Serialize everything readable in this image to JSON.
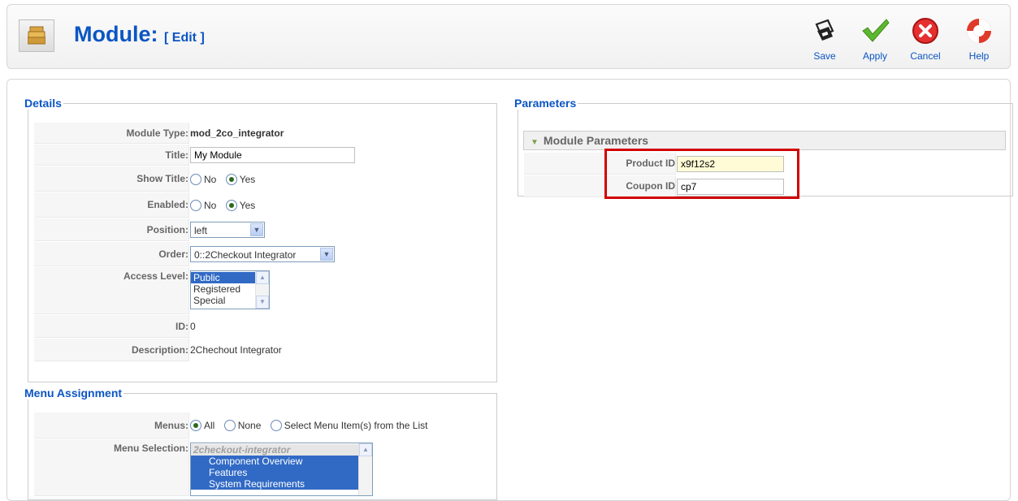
{
  "header": {
    "title": "Module:",
    "subtitle": "[ Edit ]",
    "toolbar": [
      {
        "id": "save",
        "label": "Save",
        "icon": "save-icon"
      },
      {
        "id": "apply",
        "label": "Apply",
        "icon": "checkmark-icon"
      },
      {
        "id": "cancel",
        "label": "Cancel",
        "icon": "cancel-icon"
      },
      {
        "id": "help",
        "label": "Help",
        "icon": "lifebuoy-icon"
      }
    ]
  },
  "details": {
    "legend": "Details",
    "module_type": {
      "label": "Module Type:",
      "value": "mod_2co_integrator"
    },
    "title": {
      "label": "Title:",
      "value": "My Module"
    },
    "show_title": {
      "label": "Show Title:",
      "options": [
        "No",
        "Yes"
      ],
      "selected": "Yes"
    },
    "enabled": {
      "label": "Enabled:",
      "options": [
        "No",
        "Yes"
      ],
      "selected": "Yes"
    },
    "position": {
      "label": "Position:",
      "value": "left"
    },
    "order": {
      "label": "Order:",
      "value": "0::2Checkout Integrator"
    },
    "access_level": {
      "label": "Access Level:",
      "options": [
        "Public",
        "Registered",
        "Special"
      ],
      "selected": "Public"
    },
    "id": {
      "label": "ID:",
      "value": "0"
    },
    "description": {
      "label": "Description:",
      "value": "2Chechout Integrator"
    }
  },
  "menu_assignment": {
    "legend": "Menu Assignment",
    "menus": {
      "label": "Menus:",
      "options": [
        "All",
        "None",
        "Select Menu Item(s) from the List"
      ],
      "selected": "All"
    },
    "menu_selection": {
      "label": "Menu Selection:",
      "items": [
        "2checkout-integrator",
        "Component Overview",
        "Features",
        "System Requirements"
      ]
    }
  },
  "parameters": {
    "legend": "Parameters",
    "section_title": "Module Parameters",
    "product_id": {
      "label": "Product ID",
      "value": "x9f12s2"
    },
    "coupon_id": {
      "label": "Coupon ID",
      "value": "cp7"
    }
  },
  "colors": {
    "accent": "#0b55c4",
    "highlight": "#d10000",
    "selection": "#316ac5"
  }
}
